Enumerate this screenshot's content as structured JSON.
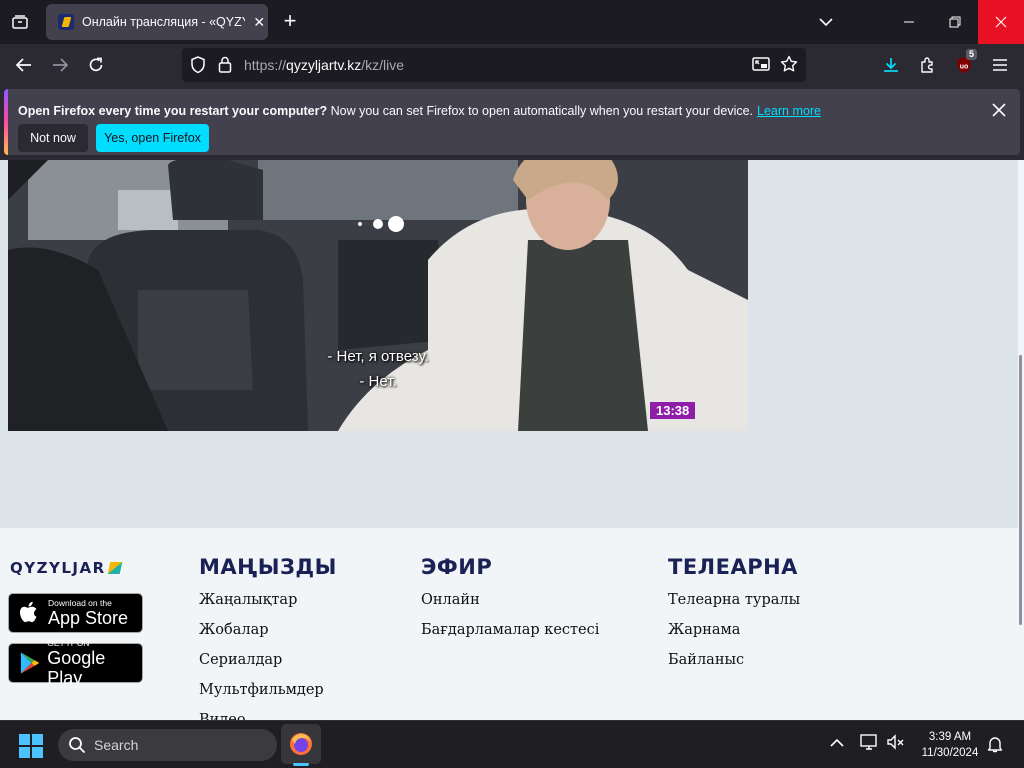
{
  "browser": {
    "tab": {
      "title": "Онлайн трансляция - «QYZYL",
      "close": "✕"
    },
    "new_tab": "+",
    "url": {
      "scheme": "https://",
      "host": "qyzyljartv.kz",
      "path": "/kz/live"
    },
    "extension_badge": "5",
    "window_colors": {
      "close_hover": "#e81123",
      "accent": "#00ddff"
    }
  },
  "notification": {
    "bold": "Open Firefox every time you restart your computer?",
    "text": " Now you can set Firefox to open automatically when you restart your device.",
    "learn_more": "Learn more",
    "not_now": "Not now",
    "yes_open": "Yes, open Firefox"
  },
  "video": {
    "subtitle_line1": "- Нет, я отвезу.",
    "subtitle_line2": "- Нет.",
    "timestamp": "13:38"
  },
  "footer": {
    "logo": "QYZYLJAR",
    "appstore": {
      "small": "Download on the",
      "big": "App Store"
    },
    "googleplay": {
      "small": "GET IT ON",
      "big": "Google Play"
    },
    "columns": [
      {
        "heading": "МАҢЫЗДЫ",
        "links": [
          "Жаңалықтар",
          "Жобалар",
          "Сериалдар",
          "Мультфильмдер",
          "Видео"
        ]
      },
      {
        "heading": "ЭФИР",
        "links": [
          "Онлайн",
          "Бағдарламалар кестесі"
        ]
      },
      {
        "heading": "ТЕЛЕАРНА",
        "links": [
          "Телеарна туралы",
          "Жарнама",
          "Байланыс"
        ]
      }
    ]
  },
  "taskbar": {
    "search_placeholder": "Search",
    "time": "3:39 AM",
    "date": "11/30/2024"
  }
}
